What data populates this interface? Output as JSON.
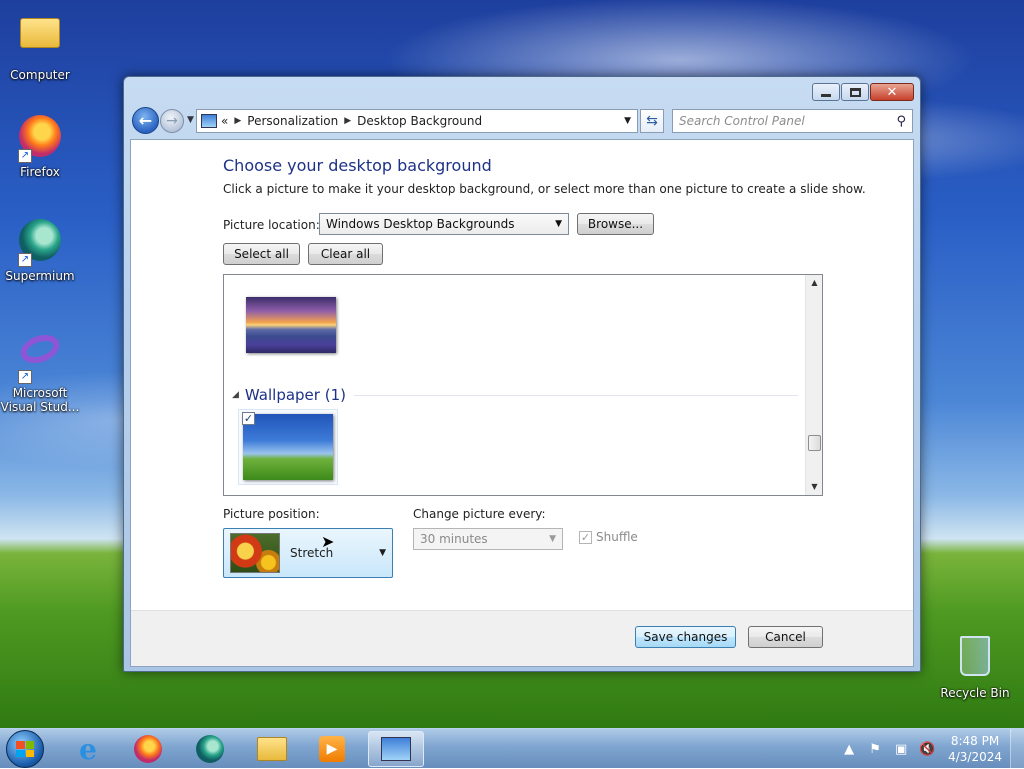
{
  "desktop": {
    "icons": [
      {
        "label": "Computer",
        "icon": "computer-folder-icon"
      },
      {
        "label": "Firefox",
        "icon": "firefox-icon"
      },
      {
        "label": "Supermium",
        "icon": "supermium-icon"
      },
      {
        "label": "Microsoft Visual Stud...",
        "icon": "visual-studio-icon"
      },
      {
        "label": "Recycle Bin",
        "icon": "recycle-bin-icon"
      }
    ]
  },
  "window": {
    "controls": {
      "minimize": "minimize",
      "maximize": "maximize",
      "close": "close"
    },
    "address": {
      "prefix": "«",
      "crumbs": [
        "Personalization",
        "Desktop Background"
      ]
    },
    "search": {
      "placeholder": "Search Control Panel"
    },
    "heading": "Choose your desktop background",
    "subheading": "Click a picture to make it your desktop background, or select more than one picture to create a slide show.",
    "picture_location": {
      "label": "Picture location:",
      "value": "Windows Desktop Backgrounds"
    },
    "browse_label": "Browse...",
    "select_all_label": "Select all",
    "clear_all_label": "Clear all",
    "picture_list": {
      "group": {
        "title": "Wallpaper (1)"
      },
      "items": [
        {
          "name": "sunset-lake-thumbnail",
          "checked": false
        },
        {
          "name": "bliss-wallpaper-thumbnail",
          "checked": true
        }
      ],
      "check_mark": "✓"
    },
    "picture_position": {
      "label": "Picture position:",
      "value": "Stretch"
    },
    "change_every": {
      "label": "Change picture every:",
      "value": "30 minutes",
      "enabled": false
    },
    "shuffle": {
      "label": "Shuffle",
      "checked": true,
      "enabled": false
    },
    "save_label": "Save changes",
    "cancel_label": "Cancel"
  },
  "taskbar": {
    "pinned": [
      "internet-explorer-icon",
      "firefox-icon",
      "supermium-icon",
      "file-explorer-icon",
      "media-player-icon",
      "control-panel-icon"
    ],
    "active": "control-panel-icon",
    "clock": {
      "time": "8:48 PM",
      "date": "4/3/2024"
    }
  },
  "colors": {
    "heading": "#1e3287",
    "accent": "#3c7fb1"
  }
}
